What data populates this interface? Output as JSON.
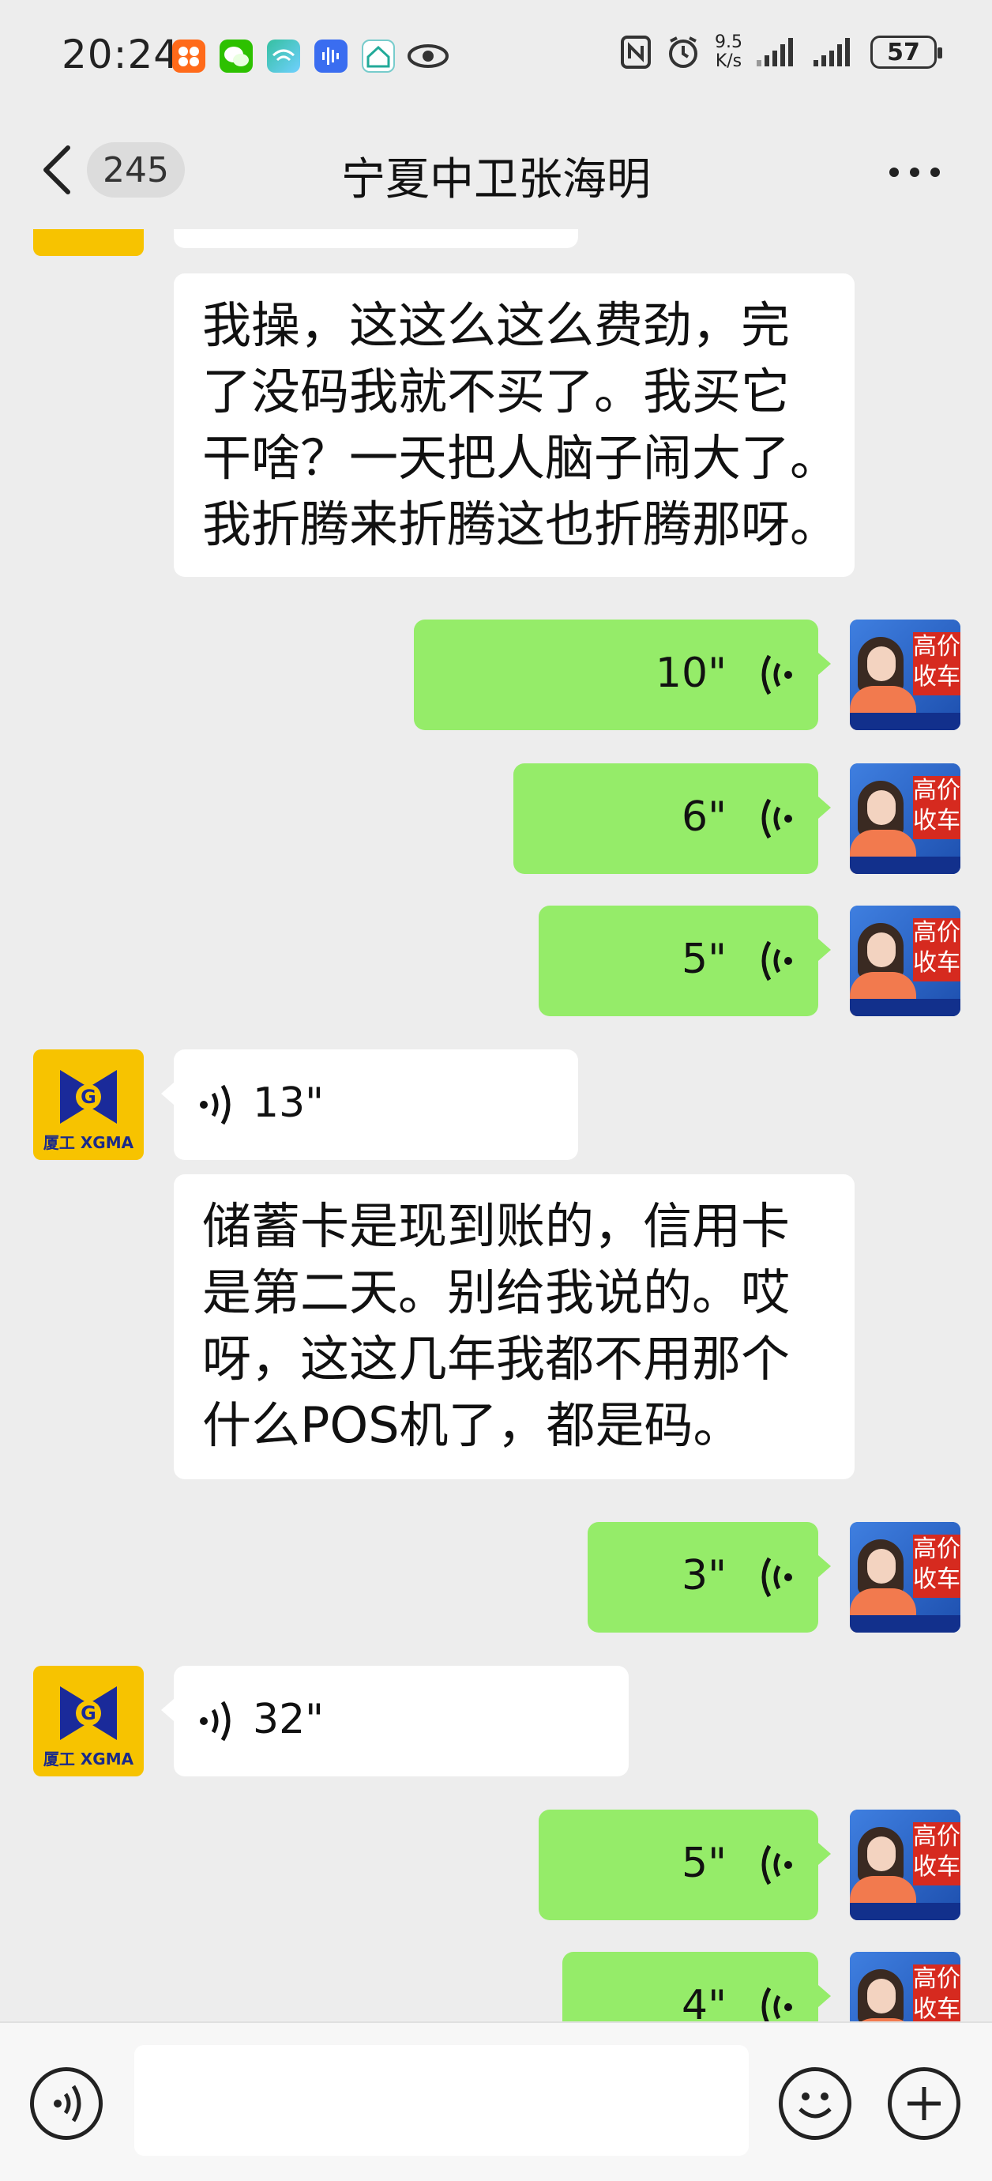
{
  "status_bar": {
    "time": "20:24",
    "net_speed_value": "9.5",
    "net_speed_unit": "K/s",
    "battery": "57",
    "app_icons": [
      "taobao-icon",
      "wechat-icon",
      "wifi-app-icon",
      "voice-recorder-icon",
      "home-app-icon",
      "eye-icon"
    ],
    "right_icons": [
      "nfc-icon",
      "alarm-icon",
      "signal-icon",
      "signal-icon",
      "battery-icon"
    ]
  },
  "header": {
    "back_icon": "chevron-left-icon",
    "unread_count": "245",
    "title": "宁夏中卫张海明",
    "more_icon": "more-dots-icon"
  },
  "messages": [
    {
      "side": "left",
      "type": "text",
      "lines": [
        "我操，这这么这么费劲，完",
        "了没码我就不买了。我买它",
        "干啥？一天把人脑子闹大了。",
        "我折腾来折腾这也折腾那呀。"
      ]
    },
    {
      "side": "right",
      "type": "voice",
      "duration": "10\""
    },
    {
      "side": "right",
      "type": "voice",
      "duration": "6\""
    },
    {
      "side": "right",
      "type": "voice",
      "duration": "5\""
    },
    {
      "side": "left",
      "type": "voice",
      "duration": "13\""
    },
    {
      "side": "left",
      "type": "text",
      "lines": [
        "储蓄卡是现到账的，信用卡",
        "是第二天。别给我说的。哎",
        "呀，这这几年我都不用那个",
        "什么POS机了，都是码。"
      ]
    },
    {
      "side": "right",
      "type": "voice",
      "duration": "3\""
    },
    {
      "side": "left",
      "type": "voice",
      "duration": "32\""
    },
    {
      "side": "right",
      "type": "voice",
      "duration": "5\""
    },
    {
      "side": "right",
      "type": "voice",
      "duration": "4\""
    }
  ],
  "avatars": {
    "left_brand": "厦工 XGMA",
    "left_logo_letter": "G",
    "right_caption": "高价收车"
  },
  "input_bar": {
    "voice_toggle_icon": "voice-mode-icon",
    "emoji_icon": "emoji-icon",
    "plus_icon": "plus-icon",
    "input_value": ""
  },
  "colors": {
    "background": "#ededed",
    "self_bubble": "#95ec69",
    "other_bubble": "#ffffff",
    "avatar_yellow": "#f7c300"
  }
}
